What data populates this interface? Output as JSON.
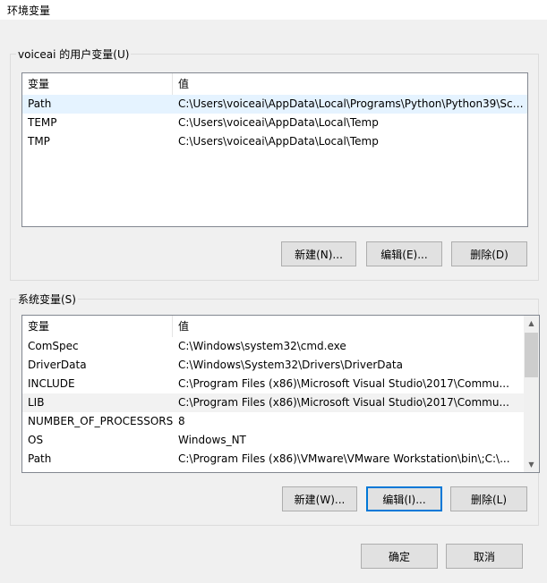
{
  "window": {
    "title": "环境变量"
  },
  "user_vars": {
    "group_label": "voiceai 的用户变量(U)",
    "col_var": "变量",
    "col_val": "值",
    "rows": [
      {
        "name": "Path",
        "value": "C:\\Users\\voiceai\\AppData\\Local\\Programs\\Python\\Python39\\Scr..."
      },
      {
        "name": "TEMP",
        "value": "C:\\Users\\voiceai\\AppData\\Local\\Temp"
      },
      {
        "name": "TMP",
        "value": "C:\\Users\\voiceai\\AppData\\Local\\Temp"
      }
    ],
    "new_label": "新建(N)...",
    "edit_label": "编辑(E)...",
    "delete_label": "删除(D)"
  },
  "system_vars": {
    "group_label": "系统变量(S)",
    "col_var": "变量",
    "col_val": "值",
    "rows": [
      {
        "name": "ComSpec",
        "value": "C:\\Windows\\system32\\cmd.exe"
      },
      {
        "name": "DriverData",
        "value": "C:\\Windows\\System32\\Drivers\\DriverData"
      },
      {
        "name": "INCLUDE",
        "value": "C:\\Program Files (x86)\\Microsoft Visual Studio\\2017\\Commu..."
      },
      {
        "name": "LIB",
        "value": "C:\\Program Files (x86)\\Microsoft Visual Studio\\2017\\Commu..."
      },
      {
        "name": "NUMBER_OF_PROCESSORS",
        "value": "8"
      },
      {
        "name": "OS",
        "value": "Windows_NT"
      },
      {
        "name": "Path",
        "value": "C:\\Program Files (x86)\\VMware\\VMware Workstation\\bin\\;C:\\..."
      }
    ],
    "new_label": "新建(W)...",
    "edit_label": "编辑(I)...",
    "delete_label": "删除(L)"
  },
  "footer": {
    "ok_label": "确定",
    "cancel_label": "取消"
  },
  "icons": {
    "scroll_up": "scroll-up-arrow-icon",
    "scroll_down": "scroll-down-arrow-icon"
  },
  "colors": {
    "default_button_border": "#0078d7",
    "row_hover": "#e5f3ff"
  }
}
